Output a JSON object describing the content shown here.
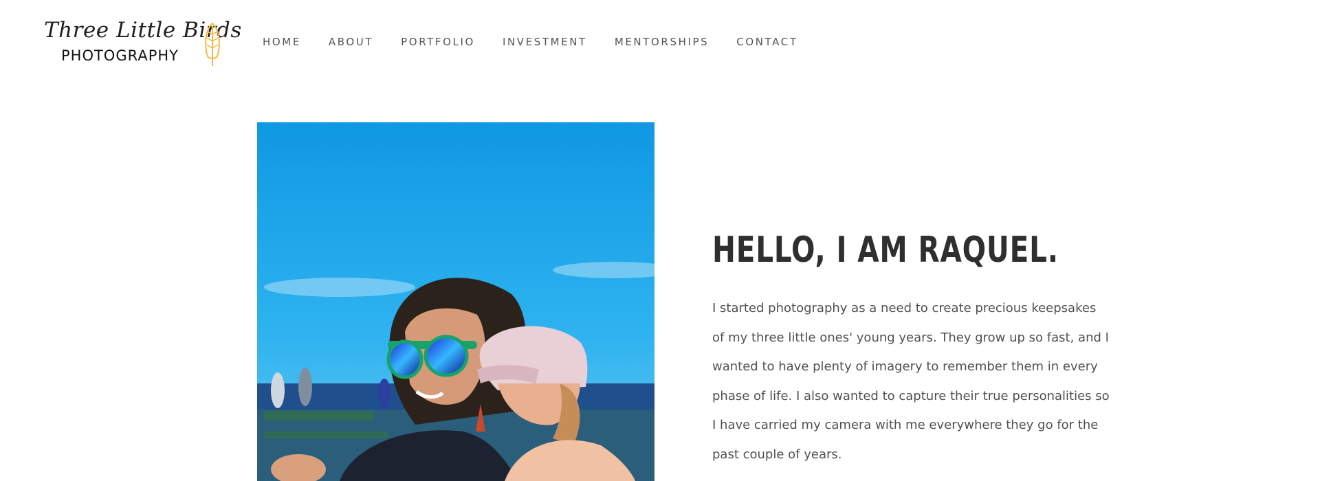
{
  "logo": {
    "script_text": "Three Little Birds",
    "subtitle": "PHOTOGRAPHY",
    "icon": "feather-icon",
    "accent_color": "#f5b942"
  },
  "nav": {
    "items": [
      {
        "label": "HOME"
      },
      {
        "label": "ABOUT"
      },
      {
        "label": "PORTFOLIO"
      },
      {
        "label": "INVESTMENT"
      },
      {
        "label": "MENTORSHIPS"
      },
      {
        "label": "CONTACT"
      }
    ]
  },
  "intro": {
    "title": "HELLO, I AM RAQUEL.",
    "body": "I started photography as a need to create precious keepsakes of my three little ones' young years. They grow up so fast, and I wanted to have plenty of imagery to remember them in every phase of life. I also wanted to capture their true personalities so I have carried my camera with me everywhere they go for the past couple of years."
  },
  "colors": {
    "sky": "#1aa3e8",
    "text_dark": "#2f2f2f",
    "text_body": "#505050"
  }
}
